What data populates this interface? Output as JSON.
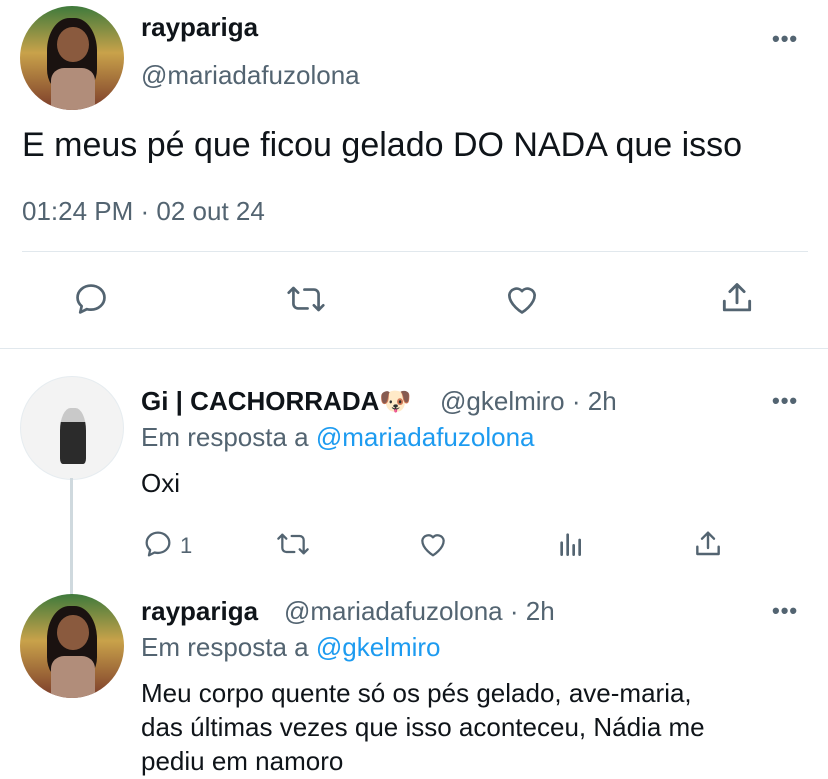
{
  "main_tweet": {
    "display_name": "raypariga",
    "handle": "@mariadafuzolona",
    "text": "E meus pé que ficou gelado DO NADA que isso",
    "timestamp": "01:24 PM · 02 out 24",
    "more": "•••",
    "actions": [
      "reply-icon",
      "retweet-icon",
      "like-icon",
      "share-icon"
    ]
  },
  "replies": [
    {
      "display_name": "Gi | CACHORRADA🐶",
      "handle_time": "@gkelmiro · 2h",
      "reply_prefix": "Em resposta a",
      "reply_target": "@mariadafuzolona",
      "text": "Oxi",
      "reply_count": "1",
      "more": "•••"
    },
    {
      "display_name": "raypariga",
      "handle_time": "@mariadafuzolona · 2h",
      "reply_prefix": "Em resposta a",
      "reply_target": "@gkelmiro",
      "text_lines": [
        "Meu corpo quente só os pés gelado, ave-maria,",
        "das últimas vezes que isso aconteceu, Nádia me",
        "pediu em namoro"
      ],
      "more": "•••"
    }
  ],
  "colors": {
    "text": "#0f1419",
    "secondary": "#536471",
    "link": "#1d9bf0",
    "divider": "#e1e8ed"
  }
}
